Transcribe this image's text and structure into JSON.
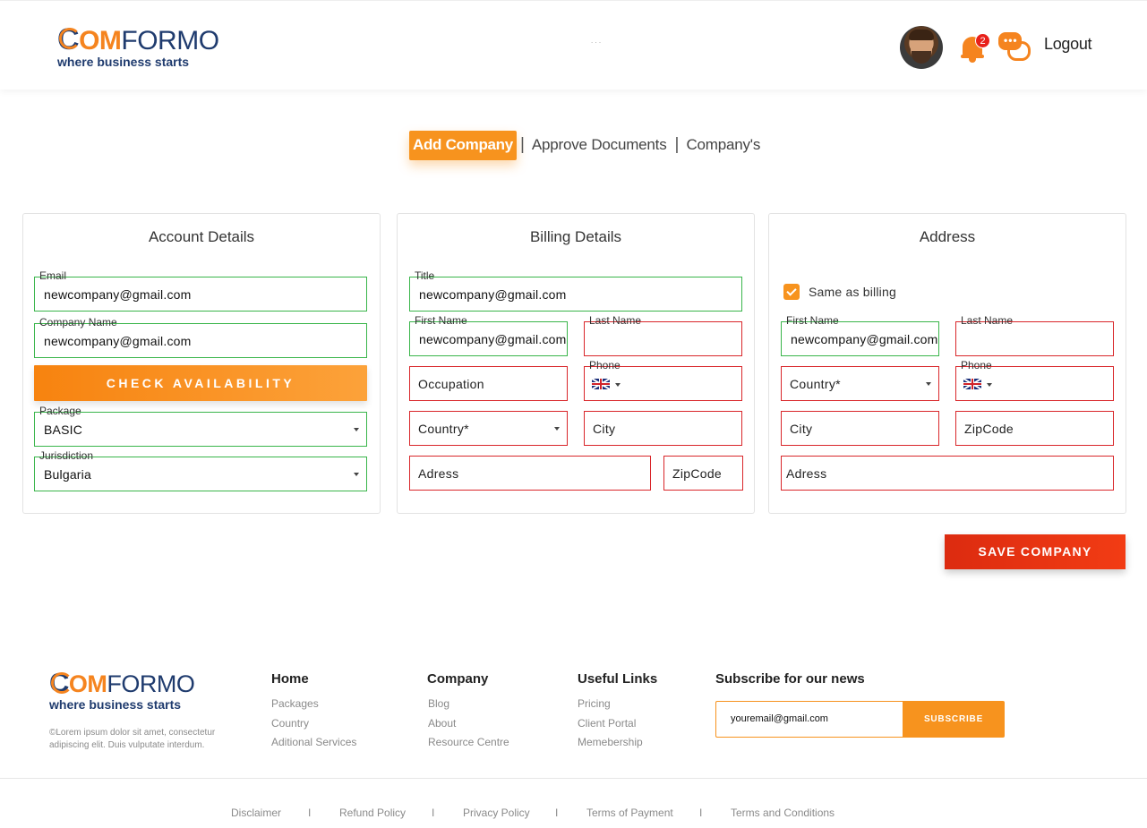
{
  "brand": {
    "c": "C",
    "om": "OM",
    "formo": "FORMO",
    "tagline": "where business starts"
  },
  "header": {
    "notifications_count": "2",
    "chat_dots": "•••",
    "logout": "Logout",
    "mid_dots": ". . ."
  },
  "tabs": {
    "active": "Add Company",
    "sep": "|",
    "approve": "Approve Documents",
    "companies": "Company's"
  },
  "account": {
    "title": "Account Details",
    "email_label": "Email",
    "email_value": "newcompany@gmail.com",
    "company_label": "Company Name",
    "company_value": "newcompany@gmail.com",
    "check_button": "CHECK AVAILABILITY",
    "package_label": "Package",
    "package_value": "BASIC",
    "jurisdiction_label": "Jurisdiction",
    "jurisdiction_value": "Bulgaria"
  },
  "billing": {
    "title": "Billing Details",
    "title_label": "Title",
    "title_value": "newcompany@gmail.com",
    "first_name_label": "First Name",
    "first_name_value": "newcompany@gmail.com",
    "last_name_label": "Last Name",
    "occupation": "Occupation",
    "phone_label": "Phone",
    "country": "Country*",
    "city": "City",
    "address": "Adress",
    "zipcode": "ZipCode"
  },
  "address": {
    "title": "Address",
    "same_as_billing": "Same as billing",
    "first_name_label": "First Name",
    "first_name_value": "newcompany@gmail.com",
    "last_name_label": "Last Name",
    "country": "Country*",
    "phone_label": "Phone",
    "city": "City",
    "zipcode": "ZipCode",
    "address": "Adress"
  },
  "save_button": "SAVE COMPANY",
  "footer": {
    "copyright": "©Lorem ipsum dolor sit amet, consectetur adipiscing elit. Duis vulputate interdum.",
    "home": {
      "title": "Home",
      "links": [
        "Packages",
        "Country",
        "Aditional Services"
      ]
    },
    "company": {
      "title": "Company",
      "links": [
        "Blog",
        "About",
        "Resource Centre"
      ]
    },
    "useful": {
      "title": "Useful Links",
      "links": [
        "Pricing",
        "Client Portal",
        "Memebership"
      ]
    },
    "subscribe": {
      "title": "Subscribe for our news",
      "email": "youremail@gmail.com",
      "button": "SUBSCRIBE"
    },
    "legal": [
      "Disclaimer",
      "I",
      "Refund Policy",
      "I",
      "Privacy Policy",
      "I",
      "Terms of Payment",
      "I",
      "Terms and Conditions"
    ]
  },
  "colors": {
    "accent": "#f7931e",
    "save": "#e3300f",
    "brand_blue": "#1f3b6e",
    "valid": "#39b54a",
    "invalid": "#d9262a"
  },
  "icons": [
    "avatar",
    "bell-icon",
    "chat-icon",
    "uk-flag-icon",
    "chevron-down-icon",
    "checkbox-checked-icon"
  ]
}
